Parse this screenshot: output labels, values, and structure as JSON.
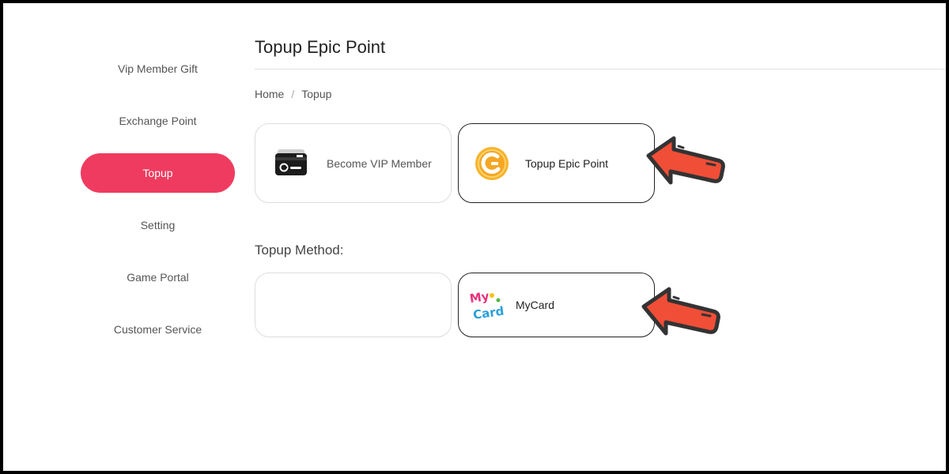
{
  "sidebar": {
    "items": [
      {
        "label": "Vip Member Gift"
      },
      {
        "label": "Exchange Point"
      },
      {
        "label": "Topup",
        "active": true
      },
      {
        "label": "Setting"
      },
      {
        "label": "Game Portal"
      },
      {
        "label": "Customer Service"
      }
    ]
  },
  "main": {
    "title": "Topup Epic Point",
    "breadcrumb": {
      "home": "Home",
      "separator": "/",
      "current": "Topup"
    },
    "options": [
      {
        "label": "Become VIP Member",
        "icon": "vip-card-icon",
        "selected": false
      },
      {
        "label": "Topup Epic Point",
        "icon": "epic-coin-icon",
        "selected": true
      }
    ],
    "method_label": "Topup Method:",
    "methods": [
      {
        "label": "",
        "icon": "",
        "selected": false
      },
      {
        "label": "MyCard",
        "icon": "mycard-logo-icon",
        "selected": true
      }
    ]
  },
  "colors": {
    "accent": "#ef3b5f",
    "arrow": "#f04e37",
    "coin": "#f5a623"
  },
  "mycard_logo": {
    "line1": "My",
    "line2": "Card"
  }
}
